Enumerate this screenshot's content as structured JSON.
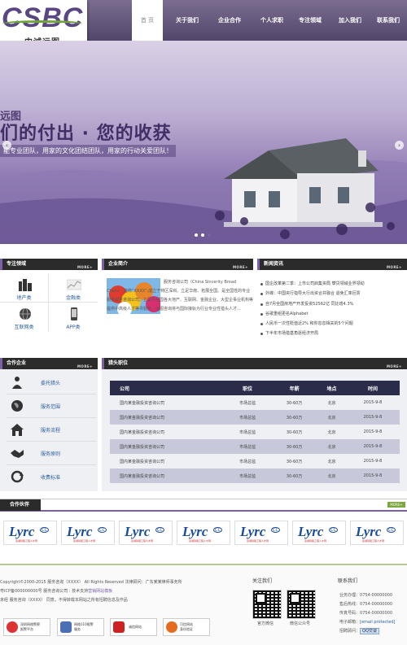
{
  "logo": {
    "text": "CSBC",
    "cn": "中诚远图"
  },
  "nav": [
    {
      "label": "首 页",
      "active": true
    },
    {
      "label": "关于我们"
    },
    {
      "label": "企业合作"
    },
    {
      "label": "个人求职"
    },
    {
      "label": "专注领域"
    },
    {
      "label": "加入我们"
    },
    {
      "label": "联系我们"
    }
  ],
  "banner": {
    "t1": "远图",
    "t2": "们的付出 · 您的收获",
    "t3": "能专业团队，用家的文化团结团队，用家的行动关爱团队！",
    "prev": "‹",
    "next": "›"
  },
  "more_label": "MORE+",
  "services": {
    "title": "专注领域",
    "items": [
      "地产类",
      "金融类",
      "互联网类",
      "APP类"
    ]
  },
  "intro": {
    "title": "企业简介",
    "text": "服务咨询公司（China Sincerity Broad Chain）,简称“XXXX”,成立于特区深圳。立足华南、拓展全国。是全国性的专业服务服务咨询公司。立足为全国各大地产、互联网、金融企业、大型企事业机构等提供中高级人才等寻服务。远图咨询将与国际接轨为行业专业性猎头人才..."
  },
  "news": {
    "title": "新闻资讯",
    "items": [
      "国企改革第二季：上市公司启集资局 攀贷领域业界领动",
      "外媒：中国央行指导大行出资合并融合 退免汇率巨贾",
      "自7月全国房地产开发投资52562亿 同比增4.3%",
      "谷歌重组更名Alphabet",
      "人民币一次性贬值近2% 和你息息相关的5个问题",
      "下半年市场猎基角逐经济开局"
    ]
  },
  "coop": {
    "title": "合作企业",
    "items": [
      "委托猎头",
      "服务范围",
      "服务流程",
      "服务原则",
      "收费标准"
    ]
  },
  "jobs": {
    "title": "猎头职位",
    "headers": [
      "公司",
      "职位",
      "年薪",
      "地点",
      "时间"
    ],
    "rows": [
      [
        "国内某金融投资咨询公司",
        "市场总监",
        "30-60万",
        "北京",
        "2015-9-8"
      ],
      [
        "国内某金融投资咨询公司",
        "市场总监",
        "30-60万",
        "北京",
        "2015-9-8"
      ],
      [
        "国内某金融投资咨询公司",
        "市场总监",
        "30-60万",
        "北京",
        "2015-9-8"
      ],
      [
        "国内某金融投资咨询公司",
        "市场总监",
        "30-60万",
        "北京",
        "2015-9-8"
      ],
      [
        "国内某金融投资咨询公司",
        "市场总监",
        "30-60万",
        "北京",
        "2015-9-8"
      ],
      [
        "国内某金融投资咨询公司",
        "市场总监",
        "30-60万",
        "北京",
        "2015-9-8"
      ]
    ]
  },
  "partners": {
    "title": "合作伙伴",
    "logo_word": "Lyrc",
    "logo_cc": "CC",
    "logo_sub": "蓝湖铁路工程人才网",
    "count": 7
  },
  "footer": {
    "line1": "Copyright©2000-2015 服务咨询（XXXX） All Rights Reserved 法律顾问：广东某某律师事务所",
    "line2": "粤ICP备000000000号 服务咨询公司 : 技术支持",
    "line2_link": "营销网站模板",
    "line3": "未经 服务咨询（XXXX） 同意，不得转载本网站之所有招聘信息及作品",
    "badges": [
      "深圳网络警察\n报警平台",
      "网络110报警\n服务",
      "诚信网站",
      "可信网站\n身份验证"
    ],
    "follow": {
      "title": "关注我们",
      "qr1": "官方微信",
      "qr2": "微信公众号"
    },
    "contact": {
      "title": "联系我们",
      "rows": [
        {
          "k": "业务办理：",
          "v": "0754-00000000"
        },
        {
          "k": "售后热线：",
          "v": "0754-00000000"
        },
        {
          "k": "传真号码：",
          "v": "0754-00000000"
        },
        {
          "k": "电子邮箱：",
          "v": "[email protected]"
        },
        {
          "k": "招聘顾问：",
          "v": "QQ交谈"
        }
      ]
    }
  },
  "colors": {
    "accent": "#7b5fa8",
    "nav_bg": "#5d5178",
    "dark": "#2b2b2b",
    "link": "#2b5e9e"
  }
}
